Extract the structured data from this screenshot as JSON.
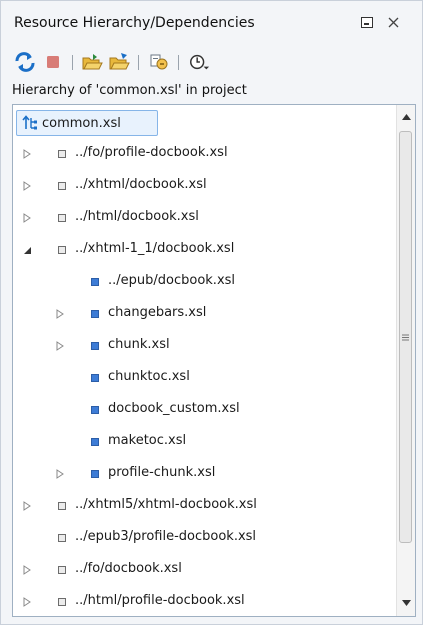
{
  "panel": {
    "title": "Resource Hierarchy/Dependencies",
    "heading": "Hierarchy of 'common.xsl' in project"
  },
  "toolbar": {
    "buttons": [
      "refresh-icon",
      "stop-icon",
      "open-folder-icon",
      "export-folder-icon",
      "configure-icon",
      "history-dropdown-icon"
    ]
  },
  "colors": {
    "selection_bg": "#e8f2fd",
    "selection_border": "#86b5e8",
    "file_icon_blue": "#3d7cd6"
  },
  "tree": {
    "root": {
      "label": "common.xsl"
    },
    "rows": [
      {
        "label": "../fo/profile-docbook.xsl",
        "twisty": "collapsed",
        "icon": "gray"
      },
      {
        "label": "../xhtml/docbook.xsl",
        "twisty": "collapsed",
        "icon": "gray"
      },
      {
        "label": "../html/docbook.xsl",
        "twisty": "collapsed",
        "icon": "gray"
      },
      {
        "label": "../xhtml-1_1/docbook.xsl",
        "twisty": "expanded",
        "icon": "gray"
      },
      {
        "label": "../epub/docbook.xsl",
        "twisty": "none",
        "icon": "blue"
      },
      {
        "label": "changebars.xsl",
        "twisty": "collapsed",
        "icon": "blue"
      },
      {
        "label": "chunk.xsl",
        "twisty": "collapsed",
        "icon": "blue"
      },
      {
        "label": "chunktoc.xsl",
        "twisty": "none",
        "icon": "blue"
      },
      {
        "label": "docbook_custom.xsl",
        "twisty": "none",
        "icon": "blue"
      },
      {
        "label": "maketoc.xsl",
        "twisty": "none",
        "icon": "blue"
      },
      {
        "label": "profile-chunk.xsl",
        "twisty": "collapsed",
        "icon": "blue"
      },
      {
        "label": "../xhtml5/xhtml-docbook.xsl",
        "twisty": "collapsed",
        "icon": "gray"
      },
      {
        "label": "../epub3/profile-docbook.xsl",
        "twisty": "none",
        "icon": "gray"
      },
      {
        "label": "../fo/docbook.xsl",
        "twisty": "collapsed",
        "icon": "gray"
      },
      {
        "label": "../html/profile-docbook.xsl",
        "twisty": "collapsed",
        "icon": "gray"
      }
    ]
  }
}
